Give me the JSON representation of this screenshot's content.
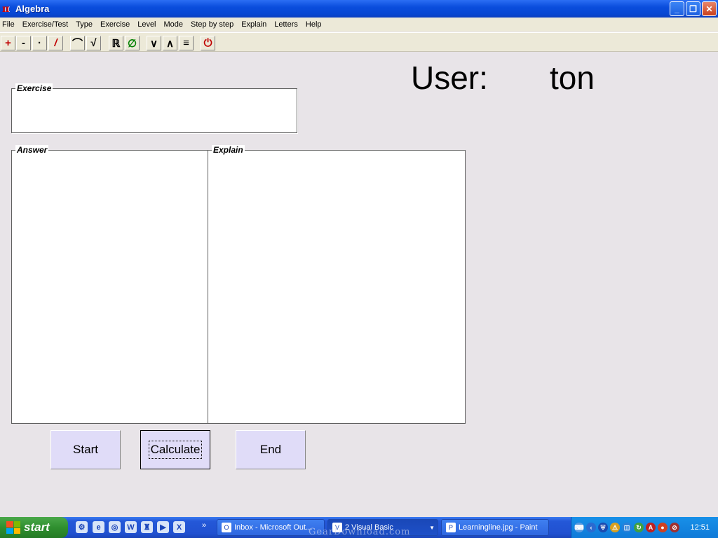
{
  "window": {
    "title": "Algebra",
    "icon_name": "algebra-app-icon"
  },
  "menu": [
    "File",
    "Exercise/Test",
    "Type",
    "Exercise",
    "Level",
    "Mode",
    "Step by step",
    "Explain",
    "Letters",
    "Help"
  ],
  "toolbar": [
    {
      "name": "plus-button",
      "glyph": "+",
      "color": "#c00000"
    },
    {
      "name": "minus-button",
      "glyph": "-",
      "color": "#000000"
    },
    {
      "name": "multiply-button",
      "glyph": "·",
      "color": "#000000"
    },
    {
      "name": "divide-button",
      "glyph": "/",
      "color": "#c00000"
    },
    {
      "name": "power-button",
      "glyph": "⌒",
      "color": "#000000"
    },
    {
      "name": "root-button",
      "glyph": "√",
      "color": "#000000"
    },
    {
      "name": "real-numbers-button",
      "glyph": "ℝ",
      "color": "#000000"
    },
    {
      "name": "empty-set-button",
      "glyph": "∅",
      "color": "#008000"
    },
    {
      "name": "or-button",
      "glyph": "∨",
      "color": "#000000"
    },
    {
      "name": "and-button",
      "glyph": "∧",
      "color": "#000000"
    },
    {
      "name": "equals-button",
      "glyph": "≡",
      "color": "#000000"
    },
    {
      "name": "power-off-button",
      "glyph": "⏻",
      "color": "#c00000"
    }
  ],
  "user": {
    "label": "User:",
    "name": "ton"
  },
  "panels": {
    "exercise": "Exercise",
    "answer": "Answer",
    "explain": "Explain"
  },
  "buttons": {
    "start": "Start",
    "calculate": "Calculate",
    "end": "End"
  },
  "taskbar": {
    "start_label": "start",
    "tasks": [
      {
        "label": "Inbox - Microsoft Out...",
        "icon": "outlook-icon"
      },
      {
        "label": "2 Visual Basic",
        "icon": "visual-basic-icon"
      },
      {
        "label": "Learningline.jpg - Paint",
        "icon": "paint-icon"
      }
    ],
    "clock": "12:51"
  },
  "watermark": "GearDownload.com"
}
